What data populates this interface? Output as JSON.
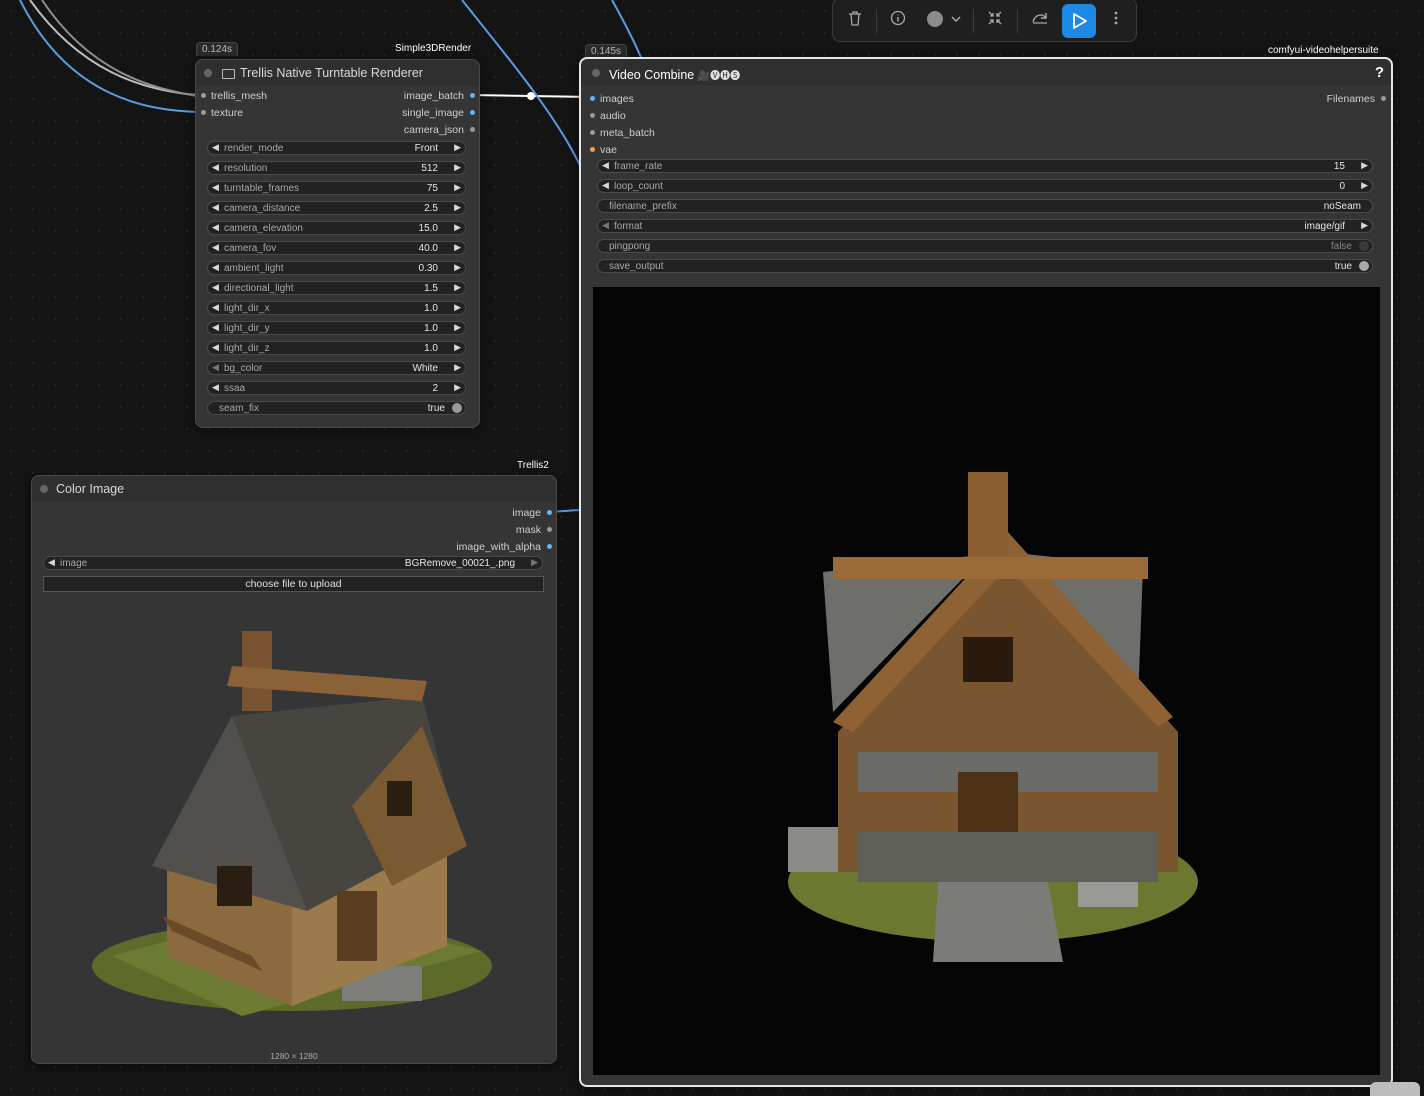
{
  "toolbar": {
    "icons": [
      "trash-icon",
      "info-icon",
      "color-circle-icon",
      "chevron-down-icon",
      "collapse-icon",
      "bypass-icon",
      "run-icon",
      "more-icon"
    ],
    "colors": {
      "accent": "#1e88e5"
    }
  },
  "nodes": {
    "turntable": {
      "time": "0.124s",
      "source": "Simple3DRender",
      "title": "Trellis Native Turntable Renderer",
      "inputs": [
        "trellis_mesh",
        "texture"
      ],
      "outputs": [
        "image_batch",
        "single_image",
        "camera_json"
      ],
      "widgets": [
        {
          "label": "render_mode",
          "value": "Front"
        },
        {
          "label": "resolution",
          "value": "512"
        },
        {
          "label": "turntable_frames",
          "value": "75"
        },
        {
          "label": "camera_distance",
          "value": "2.5"
        },
        {
          "label": "camera_elevation",
          "value": "15.0"
        },
        {
          "label": "camera_fov",
          "value": "40.0"
        },
        {
          "label": "ambient_light",
          "value": "0.30"
        },
        {
          "label": "directional_light",
          "value": "1.5"
        },
        {
          "label": "light_dir_x",
          "value": "1.0"
        },
        {
          "label": "light_dir_y",
          "value": "1.0"
        },
        {
          "label": "light_dir_z",
          "value": "1.0"
        },
        {
          "label": "bg_color",
          "value": "White"
        },
        {
          "label": "ssaa",
          "value": "2"
        }
      ],
      "toggle": {
        "label": "seam_fix",
        "value": "true"
      }
    },
    "color_image": {
      "source": "Trellis2",
      "title": "Color Image",
      "outputs": [
        "image",
        "mask",
        "image_with_alpha"
      ],
      "image_widget": {
        "label": "image",
        "value": "BGRemove_00021_.png"
      },
      "upload_label": "choose file to upload",
      "image_size": "1280 × 1280"
    },
    "video_combine": {
      "time": "0.145s",
      "source": "comfyui-videohelpersuite",
      "title": "Video Combine",
      "title_suffix": "🎥🅥🅗🅢",
      "help": "?",
      "inputs": [
        "images",
        "audio",
        "meta_batch",
        "vae"
      ],
      "outputs": [
        "Filenames"
      ],
      "widgets": [
        {
          "label": "frame_rate",
          "value": "15"
        },
        {
          "label": "loop_count",
          "value": "0"
        },
        {
          "label": "filename_prefix",
          "value": "noSeam"
        },
        {
          "label": "format",
          "value": "image/gif"
        }
      ],
      "toggles": [
        {
          "label": "pingpong",
          "value": "false"
        },
        {
          "label": "save_output",
          "value": "true"
        }
      ]
    }
  }
}
